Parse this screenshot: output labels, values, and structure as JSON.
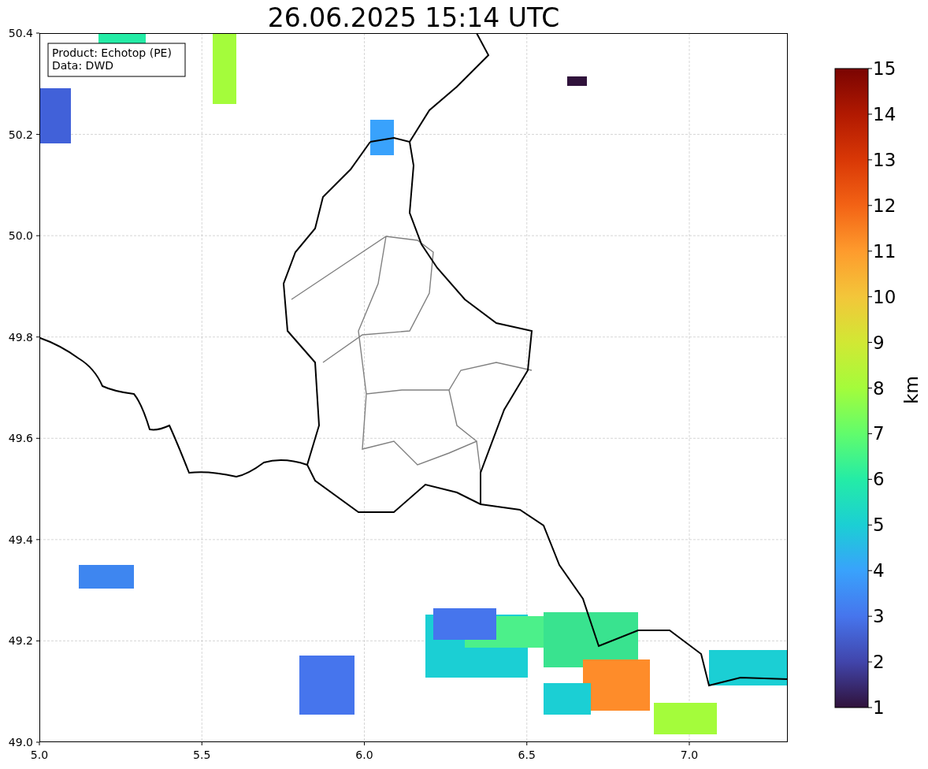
{
  "title": "26.06.2025 15:14 UTC",
  "info_box": [
    "Product: Echotop (PE)",
    "Data: DWD"
  ],
  "x_ticks": [
    "5.0",
    "5.5",
    "6.0",
    "6.5",
    "7.0"
  ],
  "y_ticks": [
    "50.4",
    "50.2",
    "50.0",
    "49.8",
    "49.6",
    "49.4",
    "49.2",
    "49.0"
  ],
  "colorbar": {
    "label": "km",
    "ticks": [
      "15",
      "14",
      "13",
      "12",
      "11",
      "10",
      "9",
      "8",
      "7",
      "6",
      "5",
      "4",
      "3",
      "2",
      "1"
    ]
  }
}
